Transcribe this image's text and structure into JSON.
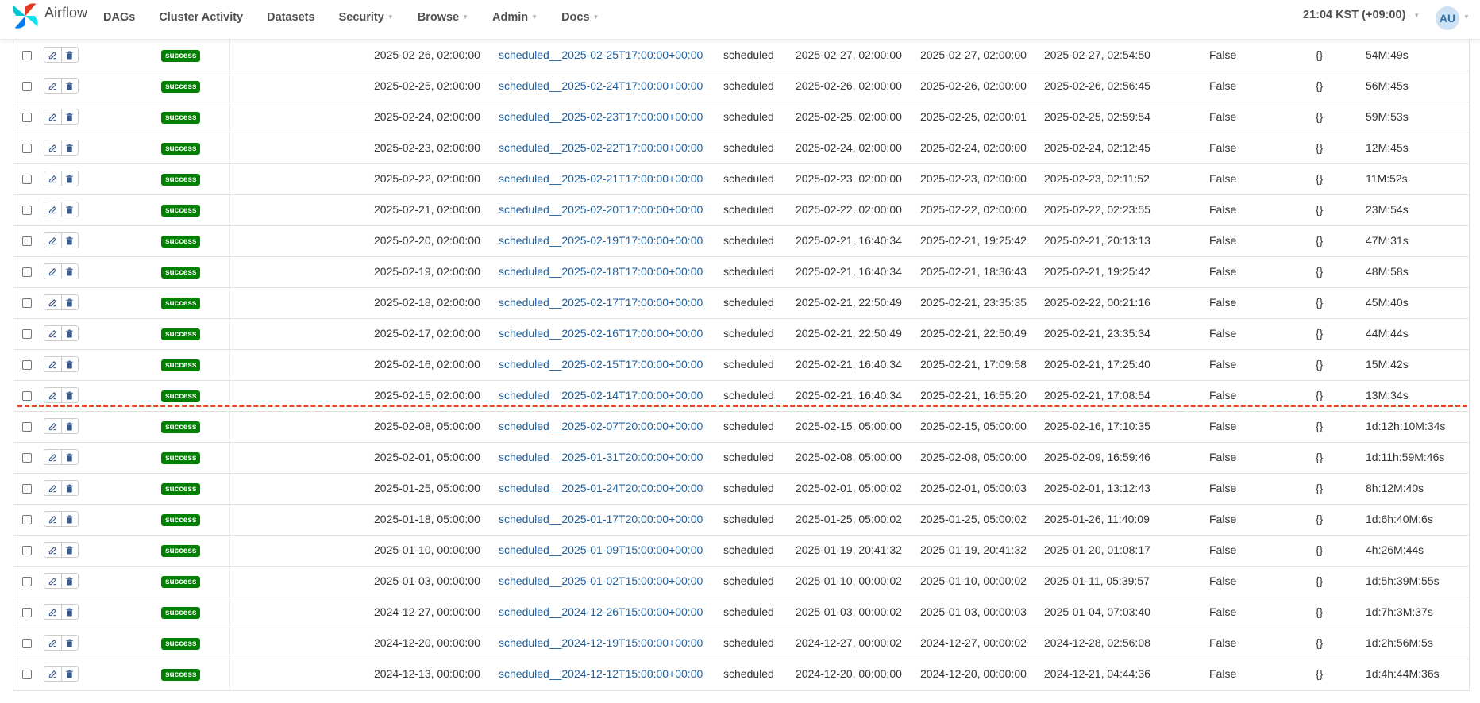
{
  "navbar": {
    "brand": "Airflow",
    "items": [
      {
        "label": "DAGs",
        "dropdown": false
      },
      {
        "label": "Cluster Activity",
        "dropdown": false
      },
      {
        "label": "Datasets",
        "dropdown": false
      },
      {
        "label": "Security",
        "dropdown": true
      },
      {
        "label": "Browse",
        "dropdown": true
      },
      {
        "label": "Admin",
        "dropdown": true
      },
      {
        "label": "Docs",
        "dropdown": true
      }
    ],
    "timezone": "21:04 KST (+09:00)",
    "user_initials": "AU"
  },
  "colors": {
    "success_badge": "#008000",
    "divider": "#e8432b",
    "link": "#1d5f9e"
  },
  "icons": {
    "edit": "edit-icon",
    "delete": "trash-icon",
    "logo": "airflow-logo"
  },
  "dag_runs": [
    {
      "state": "success",
      "logical_date": "2025-02-26, 02:00:00",
      "run_id": "scheduled__2025-02-25T17:00:00+00:00",
      "run_type": "scheduled",
      "queued_at": "2025-02-27, 02:00:00",
      "start_date": "2025-02-27, 02:00:00",
      "end_date": "2025-02-27, 02:54:50",
      "external_trigger": "False",
      "conf": "{}",
      "duration": "54M:49s"
    },
    {
      "state": "success",
      "logical_date": "2025-02-25, 02:00:00",
      "run_id": "scheduled__2025-02-24T17:00:00+00:00",
      "run_type": "scheduled",
      "queued_at": "2025-02-26, 02:00:00",
      "start_date": "2025-02-26, 02:00:00",
      "end_date": "2025-02-26, 02:56:45",
      "external_trigger": "False",
      "conf": "{}",
      "duration": "56M:45s"
    },
    {
      "state": "success",
      "logical_date": "2025-02-24, 02:00:00",
      "run_id": "scheduled__2025-02-23T17:00:00+00:00",
      "run_type": "scheduled",
      "queued_at": "2025-02-25, 02:00:00",
      "start_date": "2025-02-25, 02:00:01",
      "end_date": "2025-02-25, 02:59:54",
      "external_trigger": "False",
      "conf": "{}",
      "duration": "59M:53s"
    },
    {
      "state": "success",
      "logical_date": "2025-02-23, 02:00:00",
      "run_id": "scheduled__2025-02-22T17:00:00+00:00",
      "run_type": "scheduled",
      "queued_at": "2025-02-24, 02:00:00",
      "start_date": "2025-02-24, 02:00:00",
      "end_date": "2025-02-24, 02:12:45",
      "external_trigger": "False",
      "conf": "{}",
      "duration": "12M:45s"
    },
    {
      "state": "success",
      "logical_date": "2025-02-22, 02:00:00",
      "run_id": "scheduled__2025-02-21T17:00:00+00:00",
      "run_type": "scheduled",
      "queued_at": "2025-02-23, 02:00:00",
      "start_date": "2025-02-23, 02:00:00",
      "end_date": "2025-02-23, 02:11:52",
      "external_trigger": "False",
      "conf": "{}",
      "duration": "11M:52s"
    },
    {
      "state": "success",
      "logical_date": "2025-02-21, 02:00:00",
      "run_id": "scheduled__2025-02-20T17:00:00+00:00",
      "run_type": "scheduled",
      "queued_at": "2025-02-22, 02:00:00",
      "start_date": "2025-02-22, 02:00:00",
      "end_date": "2025-02-22, 02:23:55",
      "external_trigger": "False",
      "conf": "{}",
      "duration": "23M:54s"
    },
    {
      "state": "success",
      "logical_date": "2025-02-20, 02:00:00",
      "run_id": "scheduled__2025-02-19T17:00:00+00:00",
      "run_type": "scheduled",
      "queued_at": "2025-02-21, 16:40:34",
      "start_date": "2025-02-21, 19:25:42",
      "end_date": "2025-02-21, 20:13:13",
      "external_trigger": "False",
      "conf": "{}",
      "duration": "47M:31s"
    },
    {
      "state": "success",
      "logical_date": "2025-02-19, 02:00:00",
      "run_id": "scheduled__2025-02-18T17:00:00+00:00",
      "run_type": "scheduled",
      "queued_at": "2025-02-21, 16:40:34",
      "start_date": "2025-02-21, 18:36:43",
      "end_date": "2025-02-21, 19:25:42",
      "external_trigger": "False",
      "conf": "{}",
      "duration": "48M:58s"
    },
    {
      "state": "success",
      "logical_date": "2025-02-18, 02:00:00",
      "run_id": "scheduled__2025-02-17T17:00:00+00:00",
      "run_type": "scheduled",
      "queued_at": "2025-02-21, 22:50:49",
      "start_date": "2025-02-21, 23:35:35",
      "end_date": "2025-02-22, 00:21:16",
      "external_trigger": "False",
      "conf": "{}",
      "duration": "45M:40s"
    },
    {
      "state": "success",
      "logical_date": "2025-02-17, 02:00:00",
      "run_id": "scheduled__2025-02-16T17:00:00+00:00",
      "run_type": "scheduled",
      "queued_at": "2025-02-21, 22:50:49",
      "start_date": "2025-02-21, 22:50:49",
      "end_date": "2025-02-21, 23:35:34",
      "external_trigger": "False",
      "conf": "{}",
      "duration": "44M:44s"
    },
    {
      "state": "success",
      "logical_date": "2025-02-16, 02:00:00",
      "run_id": "scheduled__2025-02-15T17:00:00+00:00",
      "run_type": "scheduled",
      "queued_at": "2025-02-21, 16:40:34",
      "start_date": "2025-02-21, 17:09:58",
      "end_date": "2025-02-21, 17:25:40",
      "external_trigger": "False",
      "conf": "{}",
      "duration": "15M:42s"
    },
    {
      "state": "success",
      "logical_date": "2025-02-15, 02:00:00",
      "run_id": "scheduled__2025-02-14T17:00:00+00:00",
      "run_type": "scheduled",
      "queued_at": "2025-02-21, 16:40:34",
      "start_date": "2025-02-21, 16:55:20",
      "end_date": "2025-02-21, 17:08:54",
      "external_trigger": "False",
      "conf": "{}",
      "duration": "13M:34s"
    },
    {
      "state": "success",
      "logical_date": "2025-02-08, 05:00:00",
      "run_id": "scheduled__2025-02-07T20:00:00+00:00",
      "run_type": "scheduled",
      "queued_at": "2025-02-15, 05:00:00",
      "start_date": "2025-02-15, 05:00:00",
      "end_date": "2025-02-16, 17:10:35",
      "external_trigger": "False",
      "conf": "{}",
      "duration": "1d:12h:10M:34s"
    },
    {
      "state": "success",
      "logical_date": "2025-02-01, 05:00:00",
      "run_id": "scheduled__2025-01-31T20:00:00+00:00",
      "run_type": "scheduled",
      "queued_at": "2025-02-08, 05:00:00",
      "start_date": "2025-02-08, 05:00:00",
      "end_date": "2025-02-09, 16:59:46",
      "external_trigger": "False",
      "conf": "{}",
      "duration": "1d:11h:59M:46s"
    },
    {
      "state": "success",
      "logical_date": "2025-01-25, 05:00:00",
      "run_id": "scheduled__2025-01-24T20:00:00+00:00",
      "run_type": "scheduled",
      "queued_at": "2025-02-01, 05:00:02",
      "start_date": "2025-02-01, 05:00:03",
      "end_date": "2025-02-01, 13:12:43",
      "external_trigger": "False",
      "conf": "{}",
      "duration": "8h:12M:40s"
    },
    {
      "state": "success",
      "logical_date": "2025-01-18, 05:00:00",
      "run_id": "scheduled__2025-01-17T20:00:00+00:00",
      "run_type": "scheduled",
      "queued_at": "2025-01-25, 05:00:02",
      "start_date": "2025-01-25, 05:00:02",
      "end_date": "2025-01-26, 11:40:09",
      "external_trigger": "False",
      "conf": "{}",
      "duration": "1d:6h:40M:6s"
    },
    {
      "state": "success",
      "logical_date": "2025-01-10, 00:00:00",
      "run_id": "scheduled__2025-01-09T15:00:00+00:00",
      "run_type": "scheduled",
      "queued_at": "2025-01-19, 20:41:32",
      "start_date": "2025-01-19, 20:41:32",
      "end_date": "2025-01-20, 01:08:17",
      "external_trigger": "False",
      "conf": "{}",
      "duration": "4h:26M:44s"
    },
    {
      "state": "success",
      "logical_date": "2025-01-03, 00:00:00",
      "run_id": "scheduled__2025-01-02T15:00:00+00:00",
      "run_type": "scheduled",
      "queued_at": "2025-01-10, 00:00:02",
      "start_date": "2025-01-10, 00:00:02",
      "end_date": "2025-01-11, 05:39:57",
      "external_trigger": "False",
      "conf": "{}",
      "duration": "1d:5h:39M:55s"
    },
    {
      "state": "success",
      "logical_date": "2024-12-27, 00:00:00",
      "run_id": "scheduled__2024-12-26T15:00:00+00:00",
      "run_type": "scheduled",
      "queued_at": "2025-01-03, 00:00:02",
      "start_date": "2025-01-03, 00:00:03",
      "end_date": "2025-01-04, 07:03:40",
      "external_trigger": "False",
      "conf": "{}",
      "duration": "1d:7h:3M:37s"
    },
    {
      "state": "success",
      "logical_date": "2024-12-20, 00:00:00",
      "run_id": "scheduled__2024-12-19T15:00:00+00:00",
      "run_type": "scheduled",
      "queued_at": "2024-12-27, 00:00:02",
      "start_date": "2024-12-27, 00:00:02",
      "end_date": "2024-12-28, 02:56:08",
      "external_trigger": "False",
      "conf": "{}",
      "duration": "1d:2h:56M:5s"
    },
    {
      "state": "success",
      "logical_date": "2024-12-13, 00:00:00",
      "run_id": "scheduled__2024-12-12T15:00:00+00:00",
      "run_type": "scheduled",
      "queued_at": "2024-12-20, 00:00:00",
      "start_date": "2024-12-20, 00:00:00",
      "end_date": "2024-12-21, 04:44:36",
      "external_trigger": "False",
      "conf": "{}",
      "duration": "1d:4h:44M:36s"
    }
  ]
}
